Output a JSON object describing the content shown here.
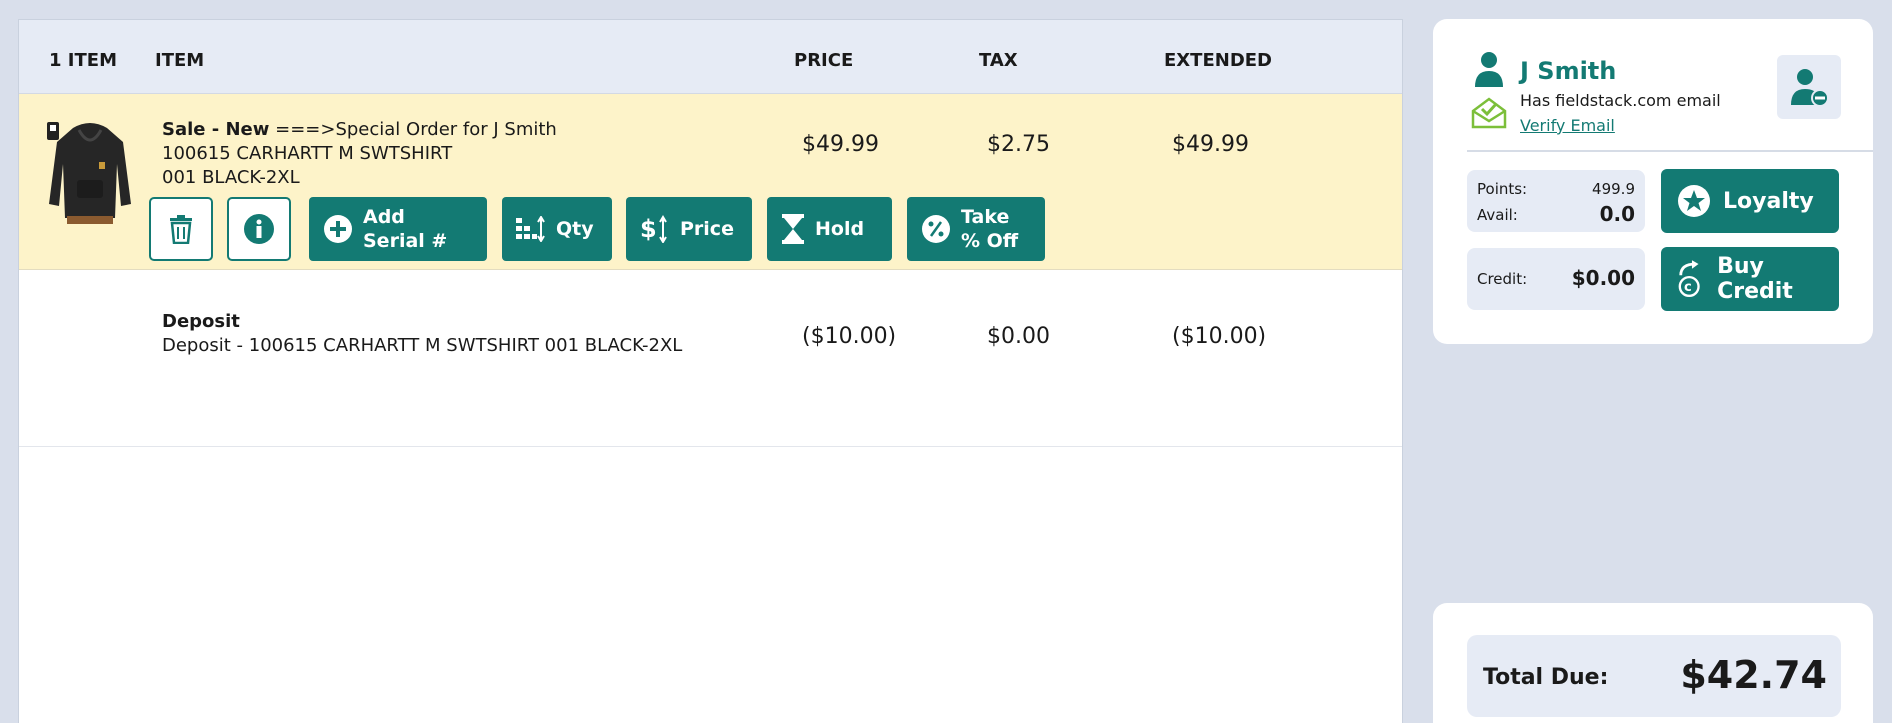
{
  "table": {
    "headers": {
      "count": "1 ITEM",
      "item": "ITEM",
      "price": "PRICE",
      "tax": "TAX",
      "extended": "EXTENDED"
    }
  },
  "sale_row": {
    "title_bold": "Sale - New",
    "title_rest": " ===>Special Order for J Smith",
    "line2": "100615 CARHARTT M SWTSHIRT",
    "line3": "001 BLACK-2XL",
    "price": "$49.99",
    "tax": "$2.75",
    "extended": "$49.99",
    "actions": {
      "add_serial_line1": "Add",
      "add_serial_line2": "Serial #",
      "qty": "Qty",
      "price": "Price",
      "hold": "Hold",
      "take_off_line1": "Take",
      "take_off_line2": "% Off"
    }
  },
  "deposit_row": {
    "title": "Deposit",
    "description": "Deposit - 100615 CARHARTT M SWTSHIRT 001 BLACK-2XL",
    "price": "($10.00)",
    "tax": "$0.00",
    "extended": "($10.00)"
  },
  "customer": {
    "name": "J Smith",
    "email_status": "Has fieldstack.com email",
    "verify_link": "Verify Email",
    "points_label": "Points:",
    "points_value": "499.9",
    "avail_label": "Avail:",
    "avail_value": "0.0",
    "credit_label": "Credit:",
    "credit_value": "$0.00",
    "loyalty_button": "Loyalty",
    "buy_credit_button": "Buy Credit"
  },
  "totals": {
    "label": "Total Due:",
    "value": "$42.74"
  },
  "colors": {
    "teal": "#137a73",
    "highlight_row": "#fdf3c9",
    "header_bg": "#e6ebf5",
    "page_bg": "#d9dfeb",
    "email_icon_green": "#7cbf3a"
  },
  "icons": {
    "person": "person-icon",
    "email_check": "email-check-icon",
    "remove_customer": "remove-customer-icon",
    "trash": "trash-icon",
    "info": "info-icon",
    "plus_circle": "plus-circle-icon",
    "qty": "qty-sort-icon",
    "price": "price-sort-icon",
    "hourglass": "hourglass-icon",
    "percent": "percent-icon",
    "star": "star-icon",
    "credit": "credit-icon"
  }
}
